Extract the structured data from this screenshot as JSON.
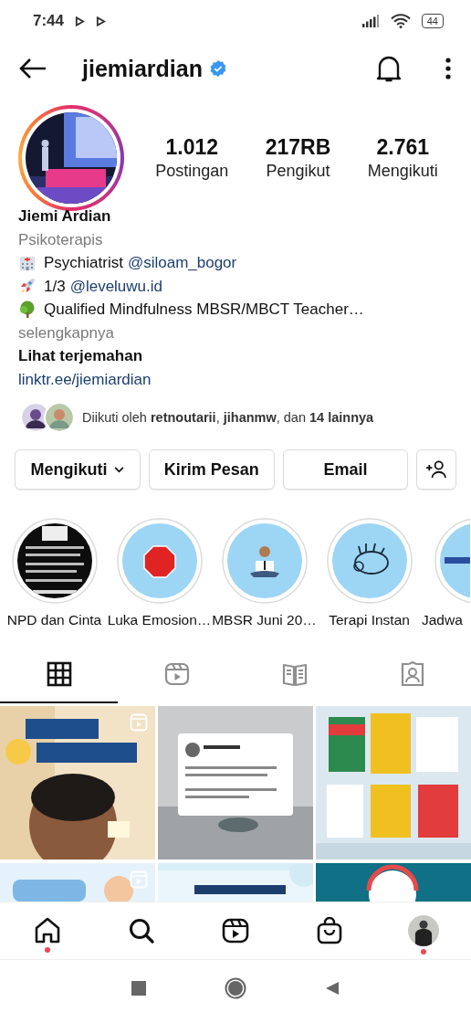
{
  "status_bar": {
    "time": "7:44",
    "battery": "44"
  },
  "header": {
    "username": "jiemiardian"
  },
  "stats": [
    {
      "value": "1.012",
      "label": "Postingan"
    },
    {
      "value": "217RB",
      "label": "Pengikut"
    },
    {
      "value": "2.761",
      "label": "Mengikuti"
    }
  ],
  "profile": {
    "name": "Jiemi Ardian",
    "category": "Psikoterapis",
    "bio_lines": [
      {
        "text": "Psychiatrist",
        "mention": "@siloam_bogor"
      },
      {
        "text": "1/3",
        "mention": "@leveluwu.id"
      },
      {
        "text": "Qualified Mindfulness MBSR/MBCT Teacher…"
      }
    ],
    "more": "selengkapnya",
    "translate": "Lihat terjemahan",
    "link": "linktr.ee/jiemiardian",
    "followed_by": "Diikuti oleh **retnoutarii**, **jihanmw**, dan **14 lainnya**"
  },
  "buttons": [
    {
      "kind": "dropdown",
      "label": "Mengikuti"
    },
    {
      "kind": "text",
      "label": "Kirim Pesan"
    },
    {
      "kind": "text",
      "label": "Email"
    },
    {
      "kind": "add-person"
    }
  ],
  "highlights": [
    {
      "label": "NPD dan Cinta"
    },
    {
      "label": "Luka Emosion…"
    },
    {
      "label": "MBSR Juni 20…"
    },
    {
      "label": "Terapi Instan"
    },
    {
      "label": "Jadwa"
    }
  ],
  "tabs": [
    {
      "kind": "grid",
      "selected": true
    },
    {
      "kind": "reels",
      "selected": false
    },
    {
      "kind": "guide",
      "selected": false
    },
    {
      "kind": "tagged",
      "selected": false
    }
  ],
  "posts": [
    {
      "kind": "picture",
      "reel": true
    },
    {
      "kind": "picture",
      "reel": false
    },
    {
      "kind": "picture",
      "reel": false
    },
    {
      "kind": "picture",
      "reel": true
    },
    {
      "kind": "picture",
      "reel": false
    },
    {
      "kind": "picture",
      "reel": false
    }
  ],
  "bottom_nav": [
    {
      "kind": "home",
      "dot": true
    },
    {
      "kind": "search",
      "dot": false
    },
    {
      "kind": "reels",
      "dot": false
    },
    {
      "kind": "shop",
      "dot": false
    },
    {
      "kind": "profile",
      "dot": true
    }
  ]
}
